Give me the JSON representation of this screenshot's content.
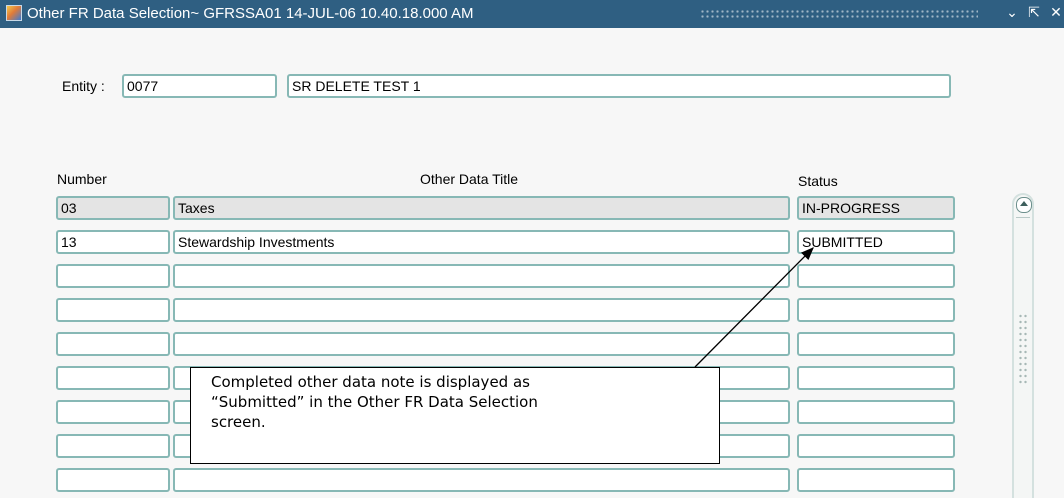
{
  "window": {
    "title": "Other FR Data Selection~ GFRSSA01  14-JUL-06 10.40.18.000 AM",
    "controls": {
      "minimize": "⌄",
      "restore": "⇱",
      "close": "✕"
    }
  },
  "entity": {
    "label": "Entity :",
    "code": "0077",
    "name": "SR DELETE TEST 1"
  },
  "table": {
    "columns": {
      "number": "Number",
      "title": "Other Data Title",
      "status": "Status"
    },
    "rows": [
      {
        "number": "03",
        "title": "Taxes",
        "status": "IN-PROGRESS"
      },
      {
        "number": "13",
        "title": "Stewardship Investments",
        "status": "SUBMITTED"
      },
      {
        "number": "",
        "title": "",
        "status": ""
      },
      {
        "number": "",
        "title": "",
        "status": ""
      },
      {
        "number": "",
        "title": "",
        "status": ""
      },
      {
        "number": "",
        "title": "",
        "status": ""
      },
      {
        "number": "",
        "title": "",
        "status": ""
      },
      {
        "number": "",
        "title": "",
        "status": ""
      },
      {
        "number": "",
        "title": "",
        "status": ""
      }
    ]
  },
  "callout": {
    "lines": [
      "Completed other data note is displayed as",
      "“Submitted” in the Other FR Data Selection",
      "screen."
    ]
  },
  "colors": {
    "titlebar": "#2f5f82",
    "field_border": "#87b8b5",
    "readonly_fill": "#e4e4e4"
  }
}
